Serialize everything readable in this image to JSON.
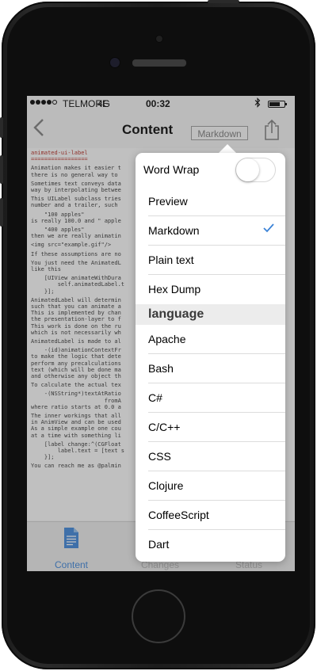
{
  "status_bar": {
    "carrier": "TELMORE",
    "network": "4G",
    "time": "00:32",
    "bluetooth_icon": "bluetooth-icon",
    "battery_icon": "battery-icon"
  },
  "navbar": {
    "title": "Content",
    "mode_label": "Markdown",
    "back_icon": "chevron-left-icon",
    "share_icon": "share-icon"
  },
  "document": {
    "lines": [
      {
        "text": "animated-ui-label",
        "accent": true
      },
      {
        "text": "=================",
        "accent": true
      },
      {
        "text": "Animation makes it easier t"
      },
      {
        "text": "there is no general way to "
      },
      {
        "text": "Sometimes text conveys data"
      },
      {
        "text": "way by interpolating betwee"
      },
      {
        "text": "This UILabel subclass tries"
      },
      {
        "text": "number and a trailer, such "
      },
      {
        "text": "    \"100 apples\""
      },
      {
        "text": "is really 100.0 and \" apple"
      },
      {
        "text": "    \"400 apples\""
      },
      {
        "text": "then we are really animatin"
      },
      {
        "text": "<img src=\"example.gif\"/>"
      },
      {
        "text": "If these assumptions are no"
      },
      {
        "text": "You just need the AnimatedL"
      },
      {
        "text": "like this"
      },
      {
        "text": "    [UIView animateWithDura"
      },
      {
        "text": "        self.animatedLabel.t"
      },
      {
        "text": "    }];"
      },
      {
        "text": "AnimatedLabel will determin"
      },
      {
        "text": "such that you can animate a"
      },
      {
        "text": "This is implemented by chan"
      },
      {
        "text": "the presentation-layer to f"
      },
      {
        "text": "This work is done on the ru"
      },
      {
        "text": "which is not necessarily wh"
      },
      {
        "text": "AnimatedLabel is made to al"
      },
      {
        "text": "    -(id)animationContextFr"
      },
      {
        "text": "to make the logic that dete"
      },
      {
        "text": "perform any precalculations"
      },
      {
        "text": "text (which will be done ma"
      },
      {
        "text": "and otherwise any object th"
      },
      {
        "text": "To calculate the actual tex"
      },
      {
        "text": "    -(NSString*)textAtRatio"
      },
      {
        "text": "                      fromA"
      },
      {
        "text": "where ratio starts at 0.0 a"
      },
      {
        "text": "The inner workings that all"
      },
      {
        "text": "in AnimView and can be used"
      },
      {
        "text": "As a simple example one cou"
      },
      {
        "text": "at a time with something li"
      },
      {
        "text": "    [label change:^(CGFloat"
      },
      {
        "text": "        label.text = [text s"
      },
      {
        "text": "    }];"
      },
      {
        "text": "You can reach me as @palmin"
      }
    ]
  },
  "tabbar": {
    "tabs": [
      {
        "label": "Content",
        "icon": "document-icon",
        "active": true
      },
      {
        "label": "Changes",
        "icon": "changes-icon",
        "active": false
      },
      {
        "label": "Status",
        "icon": "status-icon",
        "active": false
      }
    ]
  },
  "popover": {
    "word_wrap_label": "Word Wrap",
    "word_wrap_on": false,
    "options": [
      "Preview",
      "Markdown",
      "Plain text",
      "Hex Dump"
    ],
    "selected_option": "Markdown",
    "language_header": "language",
    "languages": [
      "Apache",
      "Bash",
      "C#",
      "C/C++",
      "CSS",
      "Clojure",
      "CoffeeScript",
      "Dart"
    ]
  },
  "colors": {
    "accent": "#3b83d7",
    "code_accent": "#b3281f"
  }
}
